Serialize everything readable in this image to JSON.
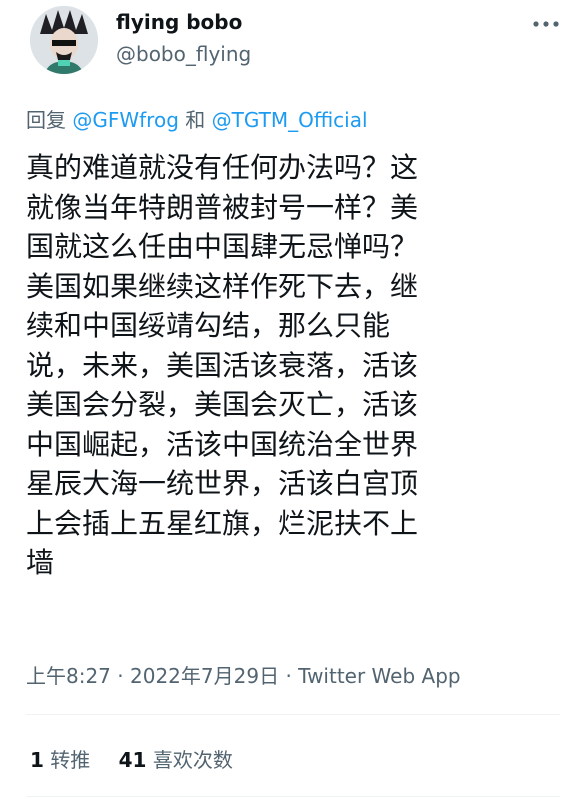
{
  "author": {
    "display_name": "flying bobo",
    "handle": "@bobo_flying",
    "avatar_icon": "profile-avatar"
  },
  "reply": {
    "prefix": "回复",
    "mention_1": "@GFWfrog",
    "joiner": "和",
    "mention_2": "@TGTM_Official"
  },
  "tweet": {
    "text": "真的难道就没有任何办法吗？这\n就像当年特朗普被封号一样？美\n国就这么任由中国肆无忌惮吗？\n美国如果继续这样作死下去，继\n续和中国绥靖勾结，那么只能\n说，未来，美国活该衰落，活该\n美国会分裂，美国会灭亡，活该\n中国崛起，活该中国统治全世界\n星辰大海一统世界，活该白宫顶\n上会插上五星红旗，烂泥扶不上\n墙"
  },
  "meta": {
    "time": "上午8:27",
    "separator": "·",
    "date": "2022年7月29日",
    "source": "Twitter Web App"
  },
  "stats": {
    "retweets_count": "1",
    "retweets_label": "转推",
    "likes_count": "41",
    "likes_label": "喜欢次数"
  },
  "colors": {
    "link": "#1d9bf0",
    "text": "#0f1419",
    "secondary": "#536471",
    "divider": "#eff3f4"
  }
}
